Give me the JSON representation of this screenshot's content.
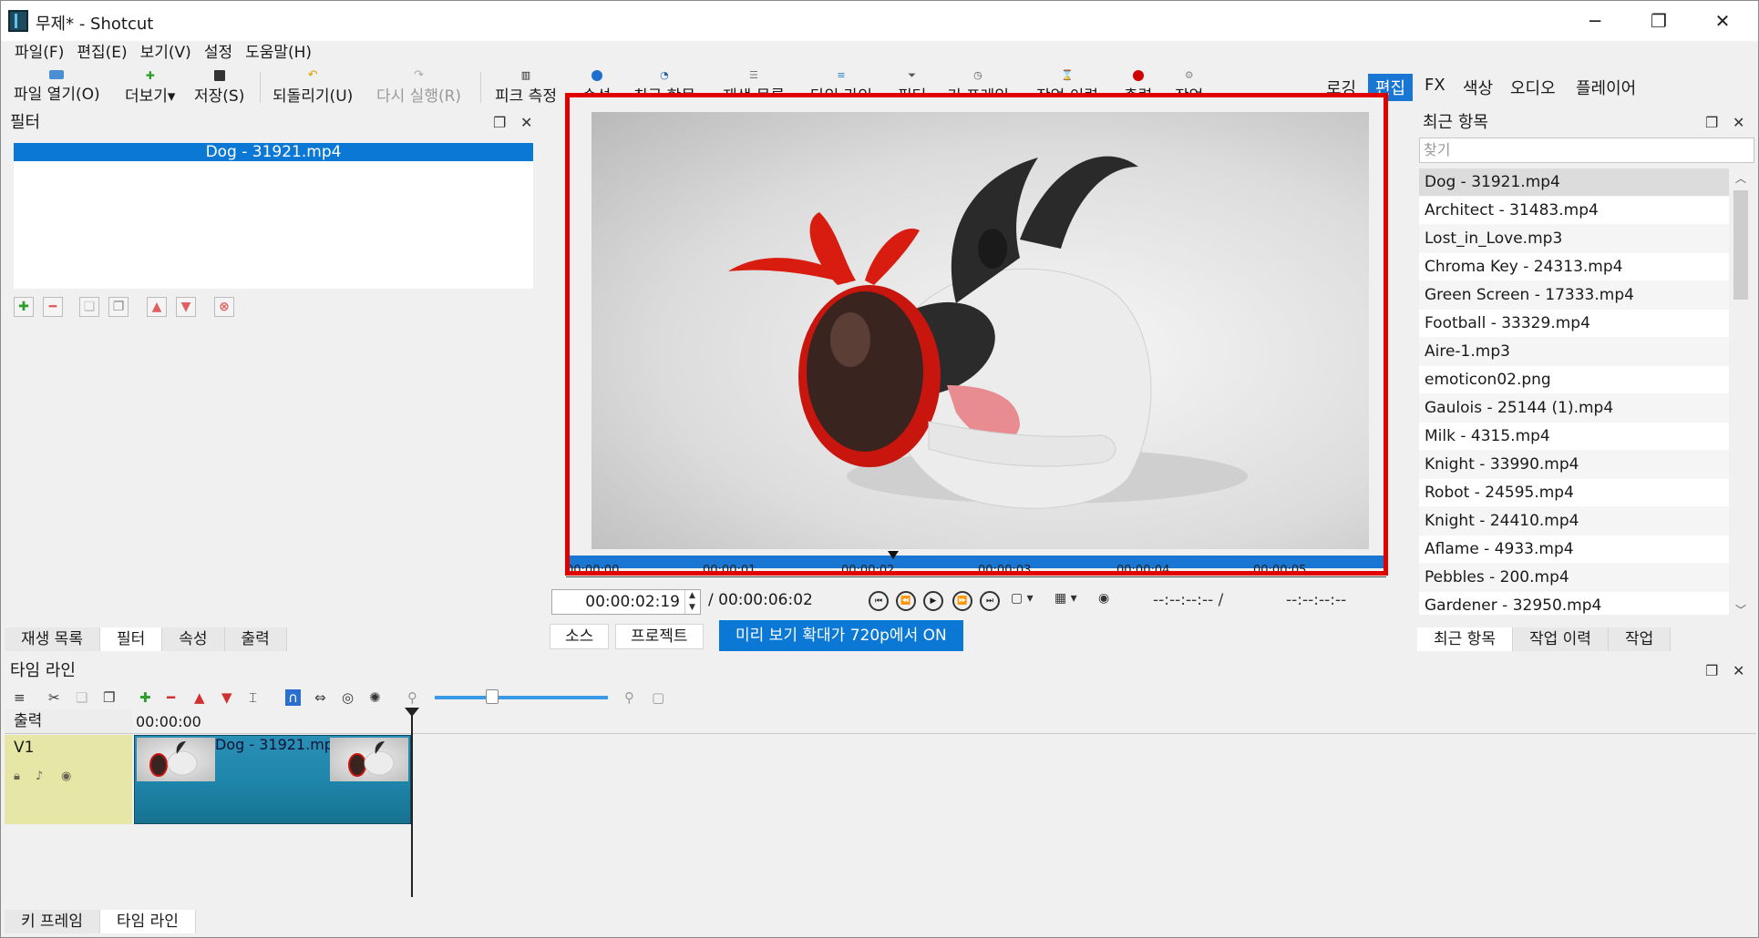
{
  "window": {
    "title": "무제* - Shotcut",
    "minimize_icon": "─",
    "restore_icon": "❐",
    "close_icon": "✕"
  },
  "menu": [
    "파일(F)",
    "편집(E)",
    "보기(V)",
    "설정",
    "도움말(H)"
  ],
  "toolbar": {
    "open": "파일 열기(O)",
    "more": "더보기",
    "save": "저장(S)",
    "undo": "되돌리기(U)",
    "redo": "다시 실행(R)",
    "peak_meter": "피크 측정",
    "properties": "속성",
    "recent": "최근 항목",
    "playlist": "재생 목록",
    "timeline": "타임 라인",
    "filters": "필터",
    "keyframes": "키 프레임",
    "history": "작업 이력",
    "export": "출력",
    "jobs": "작업"
  },
  "layouts": {
    "logging": "로깅",
    "editing": "편집",
    "fx": "FX",
    "color": "색상",
    "audio": "오디오",
    "player": "플레이어",
    "active": "편집"
  },
  "filters_panel": {
    "title": "필터",
    "selected_clip": "Dog - 31921.mp4",
    "tabs": [
      "재생 목록",
      "필터",
      "속성",
      "출력"
    ],
    "active_tab": "필터"
  },
  "viewer": {
    "scrub_ticks": [
      "00:00:00",
      "00:00:01",
      "00:00:02",
      "00:00:03",
      "00:00:04",
      "00:00:05"
    ],
    "current_timecode": "00:00:02:19",
    "total_duration": "/ 00:00:06:02",
    "in_point": "--:--:--:-- /",
    "out_point": "--:--:--:--",
    "source_tab": "소스",
    "project_tab": "프로젝트",
    "preview_scaling": "미리 보기 확대가 720p에서 ON"
  },
  "recent_panel": {
    "title": "최근 항목",
    "search_placeholder": "찾기",
    "items": [
      "Dog - 31921.mp4",
      "Architect - 31483.mp4",
      "Lost_in_Love.mp3",
      "Chroma Key - 24313.mp4",
      "Green Screen - 17333.mp4",
      "Football - 33329.mp4",
      "Aire-1.mp3",
      "emoticon02.png",
      "Gaulois - 25144 (1).mp4",
      "Milk - 4315.mp4",
      "Knight - 33990.mp4",
      "Robot - 24595.mp4",
      "Knight - 24410.mp4",
      "Aflame - 4933.mp4",
      "Pebbles - 200.mp4",
      "Gardener - 32950.mp4"
    ],
    "tabs": [
      "최근 항목",
      "작업 이력",
      "작업"
    ],
    "active_tab": "최근 항목"
  },
  "timeline_panel": {
    "title": "타임 라인",
    "output_label": "출력",
    "ruler_start": "00:00:00",
    "track_name": "V1",
    "clip_name": "Dog - 31921.mp4",
    "tabs": [
      "키 프레임",
      "타임 라인"
    ],
    "active_tab": "타임 라인"
  },
  "colors": {
    "accent": "#0a78d4",
    "highlight_box": "#e10000",
    "clip": "#1f86ac",
    "track_head": "#e6e6a6"
  }
}
